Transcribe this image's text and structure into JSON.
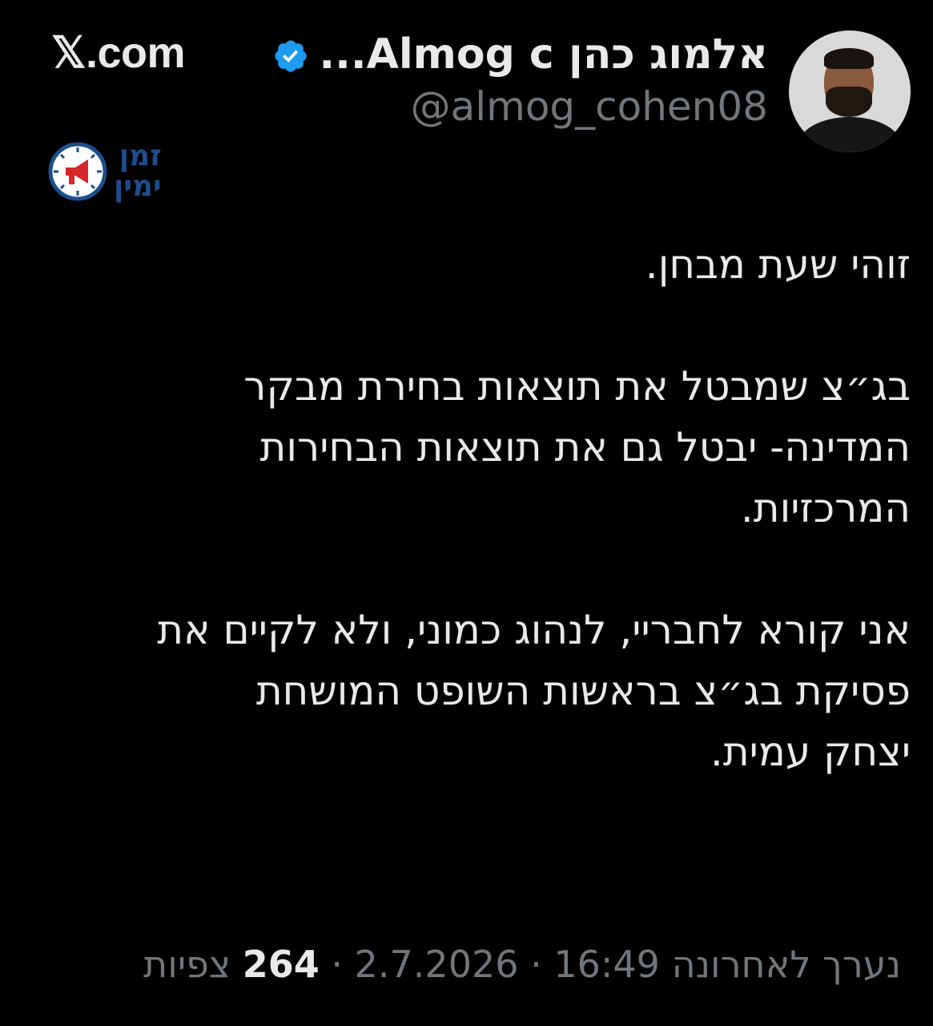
{
  "site": "𝕏.com",
  "author": {
    "display_name": "אלמוג כהן Almog c...",
    "handle": "@almog_cohen08",
    "verified": true,
    "verified_color": "#1d9bf0"
  },
  "watermark": {
    "line1": "זמן",
    "line2": "ימין",
    "color": "#1e4d8c",
    "icon": "megaphone-clock-icon"
  },
  "tweet": {
    "paragraph1": "זוהי שעת מבחן.",
    "paragraph2_line1": "בג״צ שמבטל את תוצאות בחירת מבקר",
    "paragraph2_line2": "המדינה- יבטל גם את תוצאות הבחירות",
    "paragraph2_line3": "המרכזיות.",
    "paragraph3_line1": "אני קורא לחבריי, לנהוג כמוני, ולא לקיים את",
    "paragraph3_line2": "פסיקת בג״צ בראשות השופט המושחת",
    "paragraph3_line3": "יצחק עמית."
  },
  "meta": {
    "edited_label": "נערך לאחרונה",
    "time": "16:49",
    "separator": "·",
    "date": "2.7.2026",
    "views_count": "264",
    "views_label": "צפיות"
  }
}
